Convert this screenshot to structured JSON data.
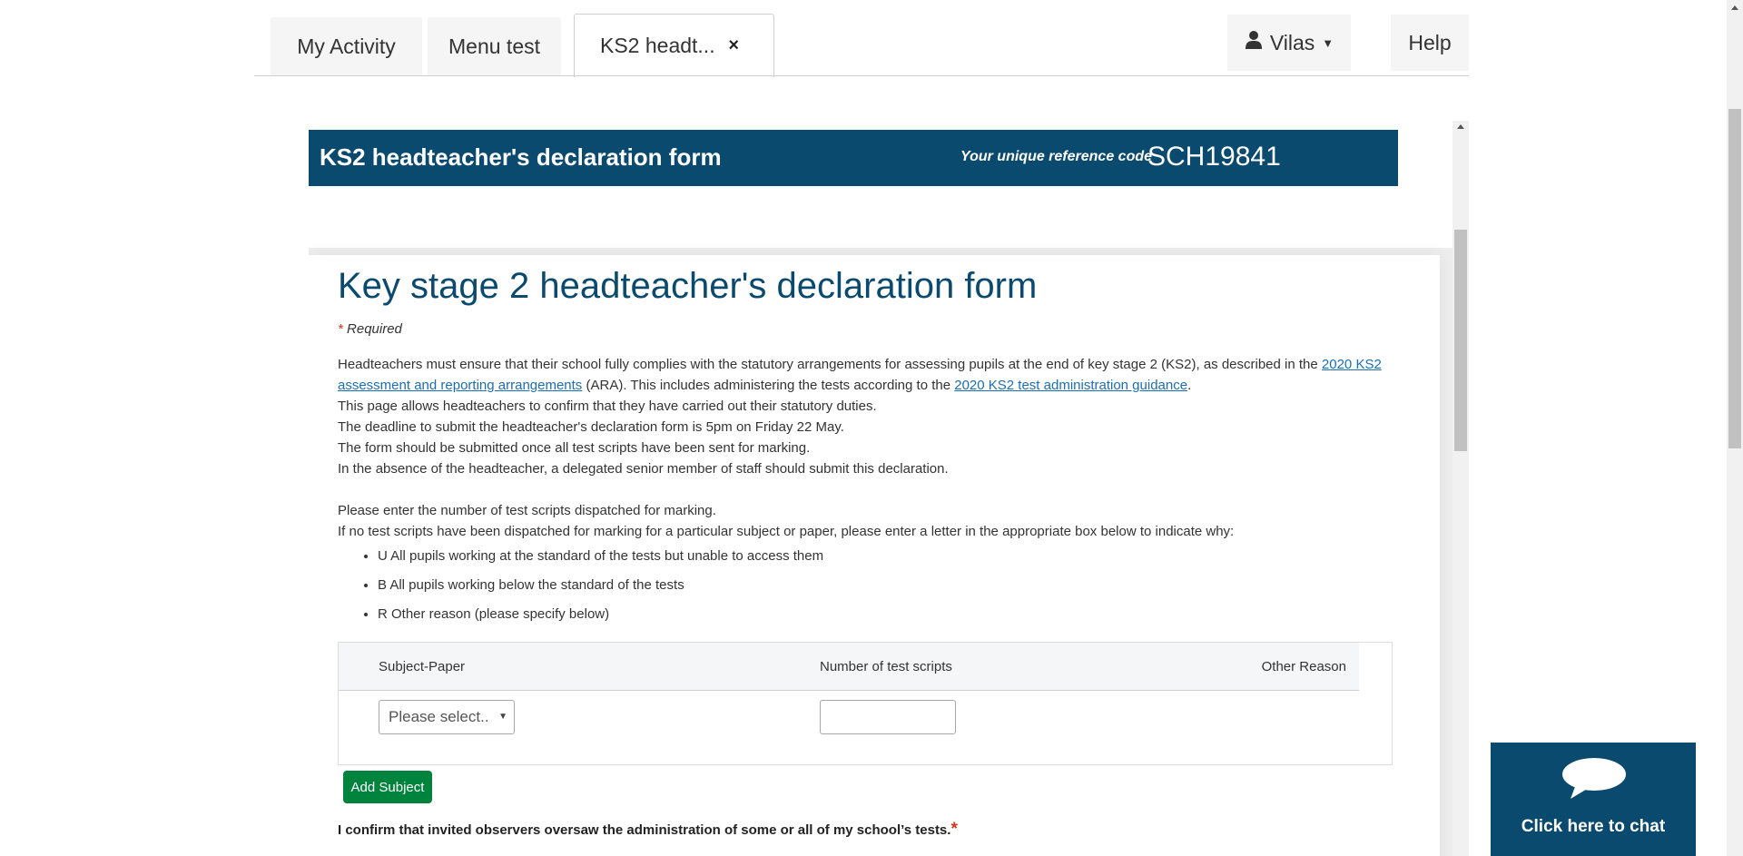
{
  "tabs": {
    "activity_label": "My Activity",
    "menu_label": "Menu test",
    "active_label": "KS2 headt...",
    "close_symbol": "×"
  },
  "user": {
    "name": "Vilas"
  },
  "help_label": "Help",
  "form_header": {
    "title": "KS2 headteacher's declaration form",
    "ref_label": "Your unique reference code",
    "ref_code": "SCH19841"
  },
  "main": {
    "title": "Key stage 2 headteacher's declaration form",
    "required_asterisk": "*",
    "required_text": "Required",
    "intro_1_start": "Headteachers must ensure that their school fully complies with the statutory arrangements for assessing pupils at the end of key stage 2 (KS2), as described in the ",
    "intro_1_link": "2020 KS2 assessment and reporting arrangements",
    "intro_1_mid": " (ARA). This includes administering the tests according to the ",
    "intro_1_link2": "2020 KS2 test administration guidance",
    "intro_1_end": ".",
    "intro_2": "This page allows headteachers to confirm that they have carried out their statutory duties.",
    "intro_3": "The deadline to submit the headteacher's declaration form is 5pm on Friday 22 May.",
    "intro_4": "The form should be submitted once all test scripts have been sent for marking.",
    "intro_5": "In the absence of the headteacher, a delegated senior member of staff should submit this declaration.",
    "instr_1": "Please enter the number of test scripts dispatched for marking.",
    "instr_2": "If no test scripts have been dispatched for marking for a particular subject or paper, please enter a letter in the appropriate box below to indicate why:",
    "reasons": [
      "U All pupils working at the standard of the tests but unable to access them",
      "B All pupils working below the standard of the tests",
      "R Other reason (please specify below)"
    ]
  },
  "table": {
    "col_subject": "Subject-Paper",
    "col_number": "Number of test scripts",
    "col_other": "Other Reason",
    "select_placeholder": "Please select..",
    "number_value": ""
  },
  "add_subject_label": "Add Subject",
  "confirm": {
    "label": "I confirm that invited observers oversaw the administration of some or all of my school’s tests.",
    "asterisk": "*"
  },
  "chat": {
    "label": "Click here to chat"
  },
  "colors": {
    "brand_navy": "#0b4a6f",
    "add_button_green": "#00843d",
    "link_blue": "#1a6eb5",
    "required_red": "#d4351c"
  },
  "icons": [
    "user-icon",
    "caret-down-icon",
    "close-icon",
    "chat-bubble-icon",
    "select-arrow-icon"
  ]
}
